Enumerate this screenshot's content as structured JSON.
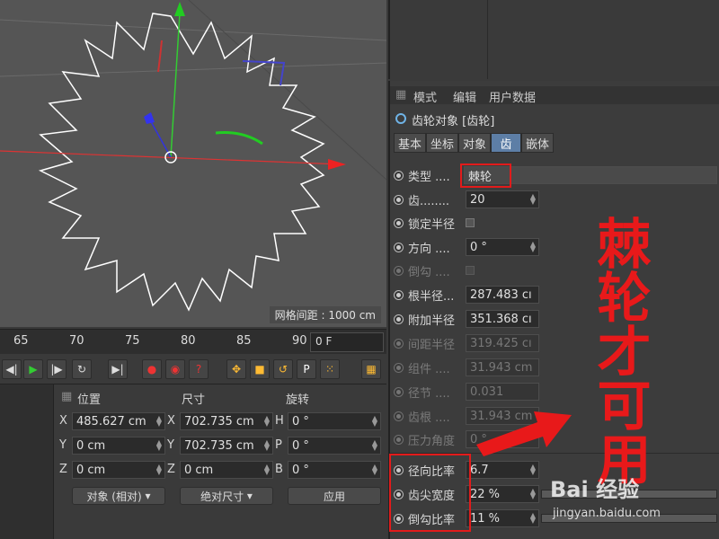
{
  "viewport": {
    "grid_label": "网格间距 : 1000 cm"
  },
  "timeline": {
    "ticks": [
      "65",
      "70",
      "75",
      "80",
      "85",
      "90"
    ],
    "frame_value": "0 F"
  },
  "coords": {
    "headers": {
      "position": "位置",
      "size": "尺寸",
      "rotation": "旋转"
    },
    "rows": [
      {
        "pos_axis": "X",
        "pos": "485.627 cm",
        "size_axis": "X",
        "size": "702.735 cm",
        "rot_axis": "H",
        "rot": "0 °"
      },
      {
        "pos_axis": "Y",
        "pos": "0 cm",
        "size_axis": "Y",
        "size": "702.735 cm",
        "rot_axis": "P",
        "rot": "0 °"
      },
      {
        "pos_axis": "Z",
        "pos": "0 cm",
        "size_axis": "Z",
        "size": "0 cm",
        "rot_axis": "B",
        "rot": "0 °"
      }
    ],
    "mode_dropdown": "对象 (相对)",
    "size_dropdown": "绝对尺寸",
    "apply_label": "应用"
  },
  "attributes": {
    "menu": [
      "模式",
      "编辑",
      "用户数据"
    ],
    "title": "齿轮对象 [齿轮]",
    "tabs": [
      "基本",
      "坐标",
      "对象",
      "齿",
      "嵌体"
    ],
    "active_tab": "齿",
    "params": [
      {
        "label": "类型 ....",
        "value": "棘轮",
        "dim": false
      },
      {
        "label": "齿........",
        "value": "20",
        "dim": false
      },
      {
        "label": "锁定半径",
        "value": "",
        "dim": false
      },
      {
        "label": "方向 ....",
        "value": "0 °",
        "dim": false
      },
      {
        "label": "倒勾 ....",
        "value": "",
        "dim": true
      },
      {
        "label": "根半径...",
        "value": "287.483 cı",
        "dim": false
      },
      {
        "label": "附加半径",
        "value": "351.368 cı",
        "dim": false
      },
      {
        "label": "间距半径",
        "value": "319.425 cı",
        "dim": true
      },
      {
        "label": "组件 ....",
        "value": "31.943 cm",
        "dim": true
      },
      {
        "label": "径节 ....",
        "value": "0.031",
        "dim": true
      },
      {
        "label": "齿根 ....",
        "value": "31.943 cm",
        "dim": true
      },
      {
        "label": "压力角度",
        "value": "0 °",
        "dim": true
      },
      {
        "label": "径向比率",
        "value": "6.7",
        "dim": false
      },
      {
        "label": "齿尖宽度",
        "value": "22 %",
        "dim": false
      },
      {
        "label": "倒勾比率",
        "value": "11 %",
        "dim": false
      }
    ]
  },
  "annotation": {
    "big_text": "棘轮才可用"
  },
  "watermark": {
    "brand": "Bai 经验",
    "url": "jingyan.baidu.com"
  },
  "colors": {
    "accent_tab": "#5d7ea6",
    "annotation_red": "#e21b1b"
  }
}
